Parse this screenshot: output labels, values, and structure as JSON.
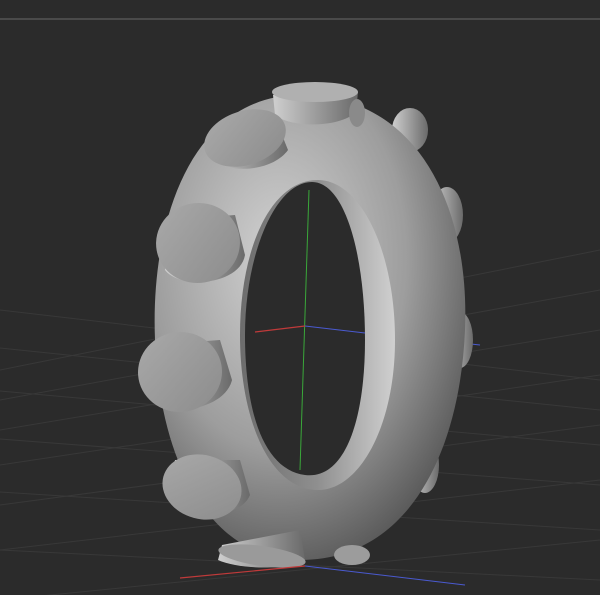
{
  "viewport": {
    "background_color": "#2b2b2b",
    "grid_color": "#3a3a3a",
    "top_line_color": "#6a6a6a"
  },
  "axes": {
    "x_axis_color": "#c03a3a",
    "y_axis_color": "#3aa83a",
    "z_axis_color": "#4a5ad0"
  },
  "model": {
    "name": "torus-with-studs",
    "material_color": "#b8b8b8",
    "stud_count": 12
  }
}
